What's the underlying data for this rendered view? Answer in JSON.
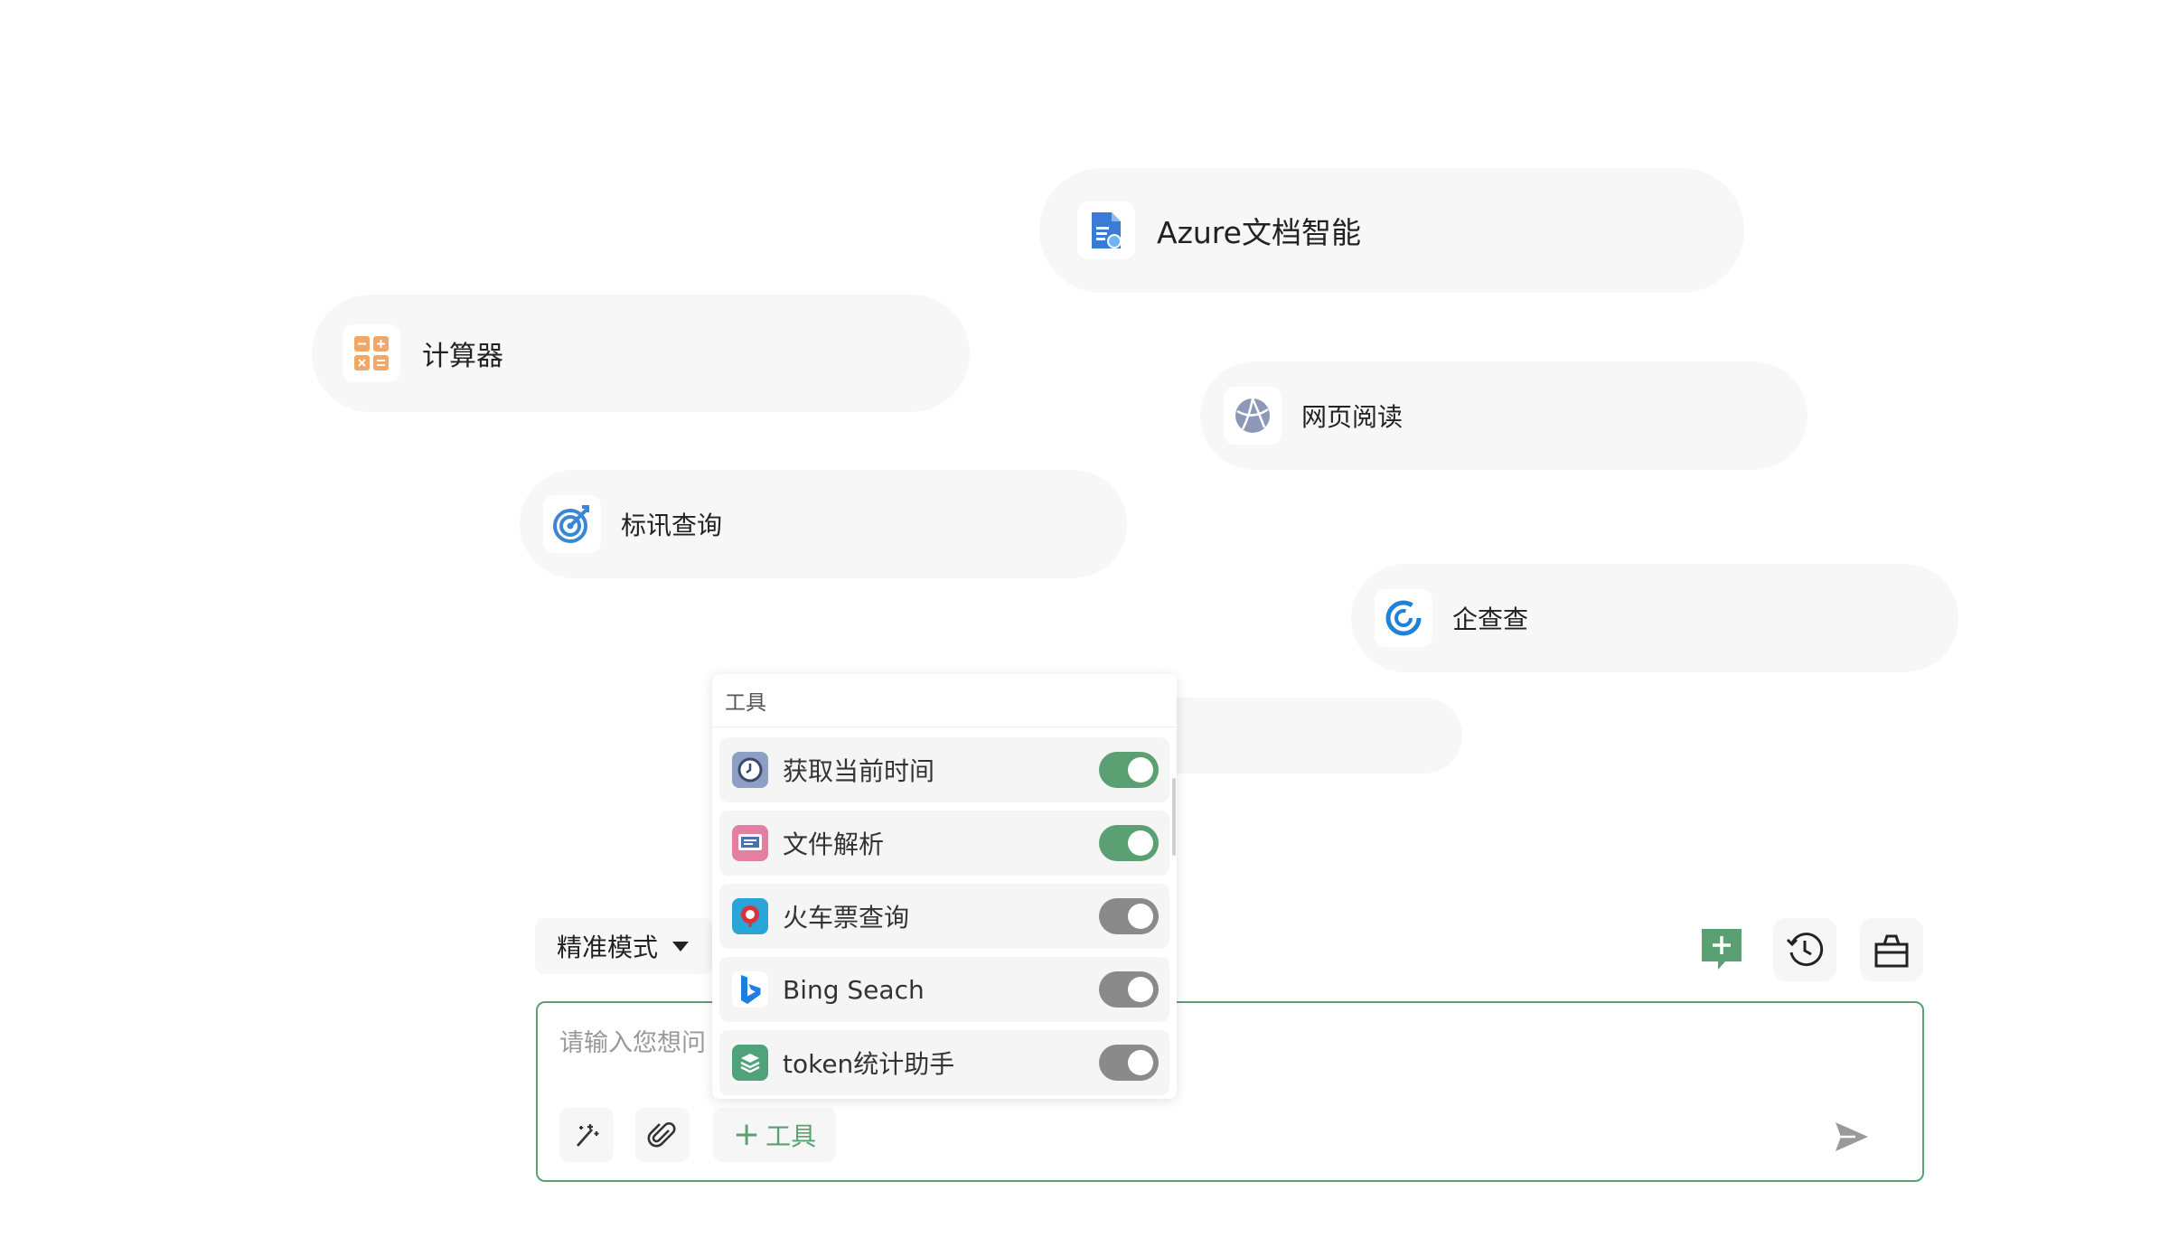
{
  "suggestions": [
    {
      "label": "Azure文档智能",
      "icon": "azure-doc-icon"
    },
    {
      "label": "计算器",
      "icon": "calculator-icon"
    },
    {
      "label": "网页阅读",
      "icon": "globe-icon"
    },
    {
      "label": "标讯查询",
      "icon": "target-icon"
    },
    {
      "label": "企查查",
      "icon": "qichacha-icon"
    }
  ],
  "tools_popover": {
    "title": "工具",
    "items": [
      {
        "name": "获取当前时间",
        "enabled": true,
        "icon": "clock-icon"
      },
      {
        "name": "文件解析",
        "enabled": true,
        "icon": "file-parse-icon"
      },
      {
        "name": "火车票查询",
        "enabled": false,
        "icon": "train-ticket-icon"
      },
      {
        "name": "Bing Seach",
        "enabled": false,
        "icon": "bing-icon"
      },
      {
        "name": "token统计助手",
        "enabled": false,
        "icon": "token-stats-icon"
      }
    ]
  },
  "mode_selector": {
    "value": "精准模式"
  },
  "input": {
    "placeholder": "请输入您想问"
  },
  "toolbar": {
    "add_tool_label": "工具"
  },
  "colors": {
    "accent": "#5aa072",
    "pill_bg": "#f7f7f7"
  }
}
